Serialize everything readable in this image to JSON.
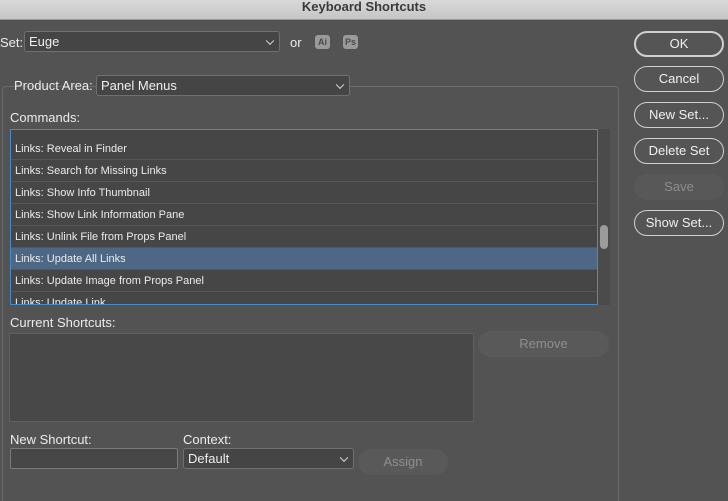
{
  "window": {
    "title": "Keyboard Shortcuts"
  },
  "set": {
    "label": "Set:",
    "value": "Euge",
    "or_label": "or",
    "app_icons": [
      "Ai",
      "Ps"
    ]
  },
  "product_area": {
    "label": "Product Area:",
    "value": "Panel Menus"
  },
  "commands": {
    "label": "Commands:",
    "items": [
      "Links: Reveal in Finder",
      "Links: Search for Missing Links",
      "Links: Show Info Thumbnail",
      "Links: Show Link Information Pane",
      "Links: Unlink File from Props Panel",
      "Links: Update All Links",
      "Links: Update Image from Props Panel",
      "Links: Update Link"
    ],
    "selected_index": 5
  },
  "current_shortcuts": {
    "label": "Current Shortcuts:",
    "remove_label": "Remove"
  },
  "new_shortcut": {
    "label": "New Shortcut:",
    "value": ""
  },
  "context": {
    "label": "Context:",
    "value": "Default"
  },
  "assign_label": "Assign",
  "buttons": {
    "ok": "OK",
    "cancel": "Cancel",
    "new_set": "New Set...",
    "delete_set": "Delete Set",
    "save": "Save",
    "show_set": "Show Set..."
  }
}
